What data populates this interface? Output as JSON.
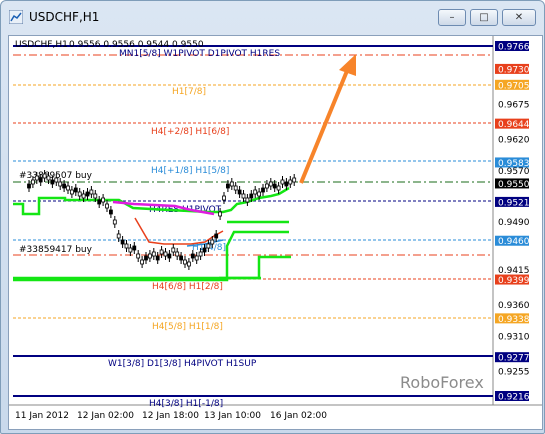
{
  "window": {
    "title": "USDCHF,H1",
    "buttons": {
      "minimize": "–",
      "maximize": "□",
      "close": "✕"
    }
  },
  "chart_info": {
    "symbol": "USDCHF,H1",
    "ohlc": "0.9556 0.9556 0.9544 0.9550"
  },
  "watermark": "RoboForex",
  "colors": {
    "navy": "#000080",
    "red": "#e8401c",
    "orange": "#f5a623",
    "blue": "#2a8cd8",
    "green": "#14e614",
    "magenta": "#e01ce0",
    "candles": "#000000",
    "arrow": "#f7842a"
  },
  "price_scale": {
    "labels": [
      "0.9766",
      "0.9730",
      "0.9705",
      "0.9675",
      "0.9644",
      "0.9620",
      "0.9583",
      "0.9570",
      "0.9550",
      "0.9521",
      "0.9490",
      "0.9460",
      "0.9415",
      "0.9399",
      "0.9360",
      "0.9338",
      "0.9310",
      "0.9277",
      "0.9255",
      "0.9216"
    ]
  },
  "time_axis": {
    "labels": [
      "11 Jan 2012",
      "12 Jan 02:00",
      "12 Jan 18:00",
      "13 Jan 10:00",
      "16 Jan 02:00"
    ]
  },
  "levels": [
    {
      "label": "MN1[5/8] W1PIVOT D1PIVOT H1RES",
      "price": "0.9766",
      "style": "navy"
    },
    {
      "label": "",
      "price": "0.9730",
      "style": "red-dash"
    },
    {
      "label": "H1[7/8]",
      "price": "0.9705",
      "style": "orange"
    },
    {
      "label": "H4[+2/8] H1[6/8]",
      "price": "0.9644",
      "style": "red"
    },
    {
      "label": "H4[+1/8] H1[5/8]",
      "price": "0.9583",
      "style": "blue"
    },
    {
      "label": "H4RES H1PIVOT",
      "price": "0.9521",
      "style": "navy-dash"
    },
    {
      "label": "",
      "price": "0.9460",
      "style": "blue-tag"
    },
    {
      "label": "H4[6/8] H1[2/8]",
      "price": "0.9399",
      "style": "red"
    },
    {
      "label": "H4[5/8] H1[1/8]",
      "price": "0.9338",
      "style": "orange"
    },
    {
      "label": "W1[3/8] D1[3/8] H4PIVOT H1SUP",
      "price": "0.9277",
      "style": "navy"
    },
    {
      "label": "H4[3/8] H1[-1/8]",
      "price": "0.9216",
      "style": "navy"
    }
  ],
  "orders": [
    {
      "label": "#33869507 buy"
    },
    {
      "label": "#33859417 buy"
    }
  ],
  "partial_label": "H1[4/8]"
}
